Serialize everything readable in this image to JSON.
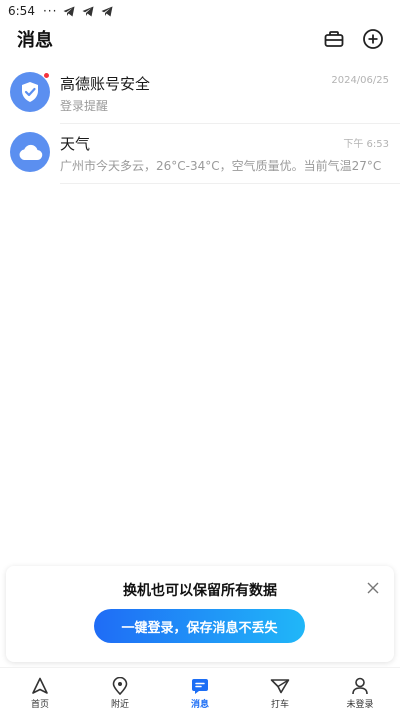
{
  "status_bar": {
    "time": "6:54",
    "dots": "···"
  },
  "header": {
    "title": "消息"
  },
  "messages": [
    {
      "name": "高德账号安全",
      "time": "2024/06/25",
      "preview": "登录提醒",
      "icon": "shield-check-icon",
      "unread": true
    },
    {
      "name": "天气",
      "time": "下午 6:53",
      "preview": "广州市今天多云，26°C-34°C，空气质量优。当前气温27°C",
      "icon": "cloud-icon",
      "unread": false
    }
  ],
  "login_card": {
    "title": "换机也可以保留所有数据",
    "button_label": "一键登录，保存消息不丢失"
  },
  "tabs": [
    {
      "label": "首页",
      "icon": "navigation-arrow-icon",
      "active": false
    },
    {
      "label": "附近",
      "icon": "location-pin-icon",
      "active": false
    },
    {
      "label": "消息",
      "icon": "chat-bubble-icon",
      "active": true
    },
    {
      "label": "打车",
      "icon": "taxi-icon",
      "active": false
    },
    {
      "label": "未登录",
      "icon": "user-icon",
      "active": false
    }
  ],
  "colors": {
    "accent": "#1c6ef5",
    "avatar_blue": "#5b8ff0",
    "unread_dot": "#f4333c"
  }
}
